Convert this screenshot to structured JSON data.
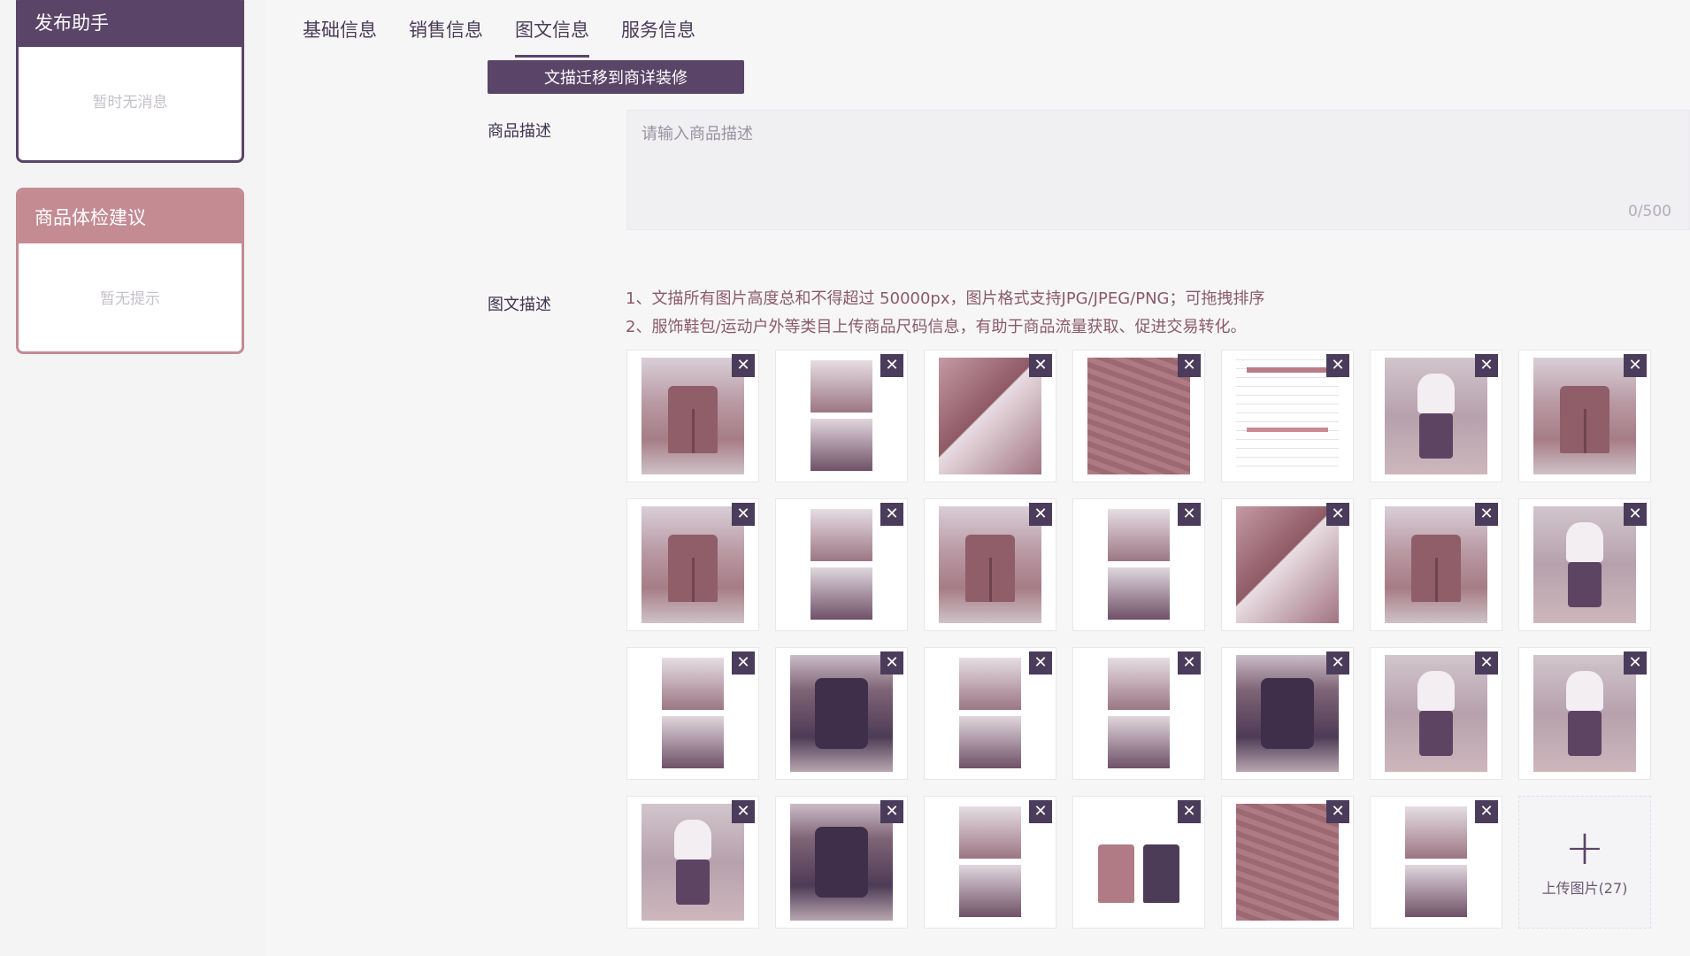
{
  "left_panel": {
    "assistant": {
      "title": "发布助手",
      "empty_text": "暂时无消息"
    },
    "advice": {
      "title": "商品体检建议",
      "empty_text": "暂无提示"
    }
  },
  "tabs": [
    {
      "label": "基础信息",
      "active": false
    },
    {
      "label": "销售信息",
      "active": false
    },
    {
      "label": "图文信息",
      "active": true
    },
    {
      "label": "服务信息",
      "active": false
    }
  ],
  "migrate_button": "文描迁移到商详装修",
  "description": {
    "label": "商品描述",
    "placeholder": "请输入商品描述",
    "counter": "0/500"
  },
  "rich_desc": {
    "label": "图文描述",
    "tips": [
      "1、文描所有图片高度总和不得超过 50000px，图片格式支持JPG/JPEG/PNG；可拖拽排序",
      "2、服饰鞋包/运动户外等类目上传商品尺码信息，有助于商品流量获取、促进交易转化。"
    ]
  },
  "gallery": {
    "close_symbol": "✕",
    "upload_symbol": "+",
    "upload_label": "上传图片(27)",
    "images": [
      "pants-photo",
      "split-photo",
      "detail-photo",
      "fabric-photo",
      "table-photo",
      "kid-photo",
      "pants-photo",
      "pants-photo",
      "split-photo",
      "pants-photo",
      "split-photo",
      "detail-photo",
      "pants-photo",
      "kid-photo",
      "split-photo",
      "dark-photo",
      "split-photo",
      "split-photo",
      "dark-photo",
      "kid-photo",
      "kid-photo",
      "kid-photo",
      "dark-photo",
      "split-photo",
      "flat-pants",
      "fabric-photo",
      "split-photo"
    ]
  },
  "colors": {
    "primary": "#5a4468",
    "advice": "#c48b93",
    "tips_text": "#8a5a6a"
  }
}
